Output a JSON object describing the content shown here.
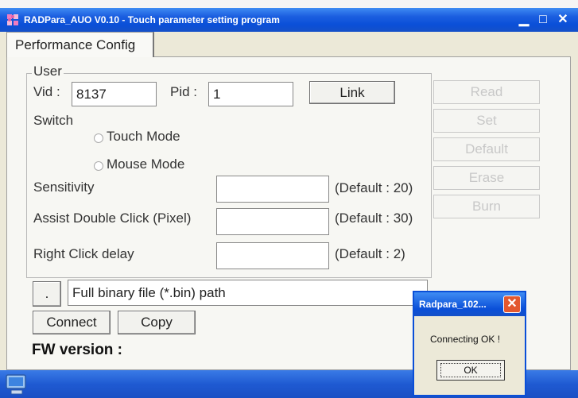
{
  "window": {
    "title": "RADPara_AUO V0.10 - Touch parameter setting program",
    "minimize_glyph": "▁",
    "maximize_glyph": "□",
    "close_glyph": "✕",
    "icon": "app-puzzle-icon"
  },
  "tab": {
    "label": "Performance Config"
  },
  "user_group": {
    "legend": "User",
    "vid_label": "Vid :",
    "vid_value": "8137",
    "pid_label": "Pid :",
    "pid_value": "1",
    "link_button": "Link"
  },
  "switch": {
    "label": "Switch",
    "options": [
      "Touch Mode",
      "Mouse Mode"
    ]
  },
  "params": [
    {
      "label": "Sensitivity",
      "value": "",
      "default": "(Default : 20)"
    },
    {
      "label": "Assist Double Click (Pixel)",
      "value": "",
      "default": "(Default : 30)"
    },
    {
      "label": "Right Click delay",
      "value": "",
      "default": "(Default : 2)"
    }
  ],
  "side_buttons": [
    "Read",
    "Set",
    "Default",
    "Erase",
    "Burn"
  ],
  "file": {
    "browse_button": ".",
    "path_value": "Full binary file (*.bin) path"
  },
  "connect_button": "Connect",
  "copy_button": "Copy",
  "fw_version_label": "FW version :",
  "dialog": {
    "title": "Radpara_102...",
    "message": "Connecting OK !",
    "ok_button": "OK",
    "close_glyph": "✕"
  },
  "taskbar": {
    "icon": "computer-icon"
  },
  "colors": {
    "titlebar_blue": "#0a4fd8",
    "window_face": "#ece9d8",
    "close_red": "#e3582f"
  }
}
